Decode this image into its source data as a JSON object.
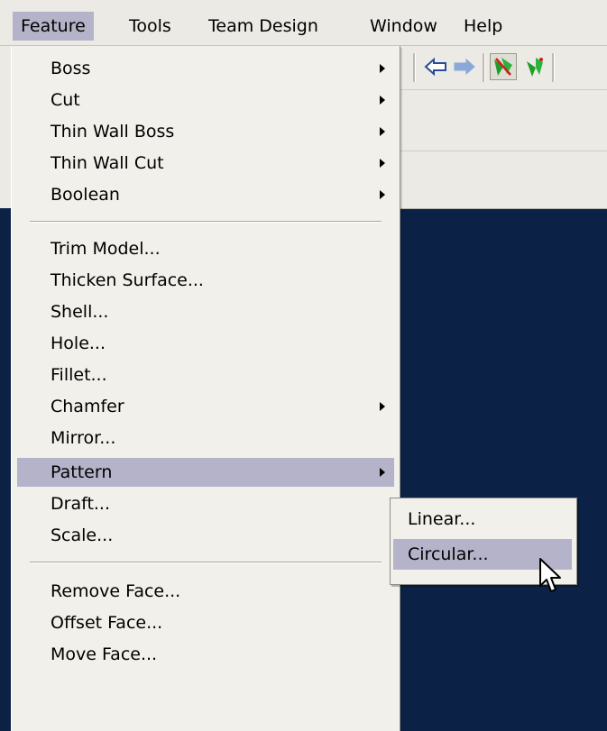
{
  "menubar": {
    "items": [
      {
        "label": "Feature",
        "active": true
      },
      {
        "label": "Tools"
      },
      {
        "label": "Team Design"
      },
      {
        "label": "Window"
      },
      {
        "label": "Help"
      }
    ]
  },
  "toolbar": {
    "icons": [
      "back-arrow-icon",
      "forward-arrow-icon",
      "green-red-feature-icon",
      "green-feature-icon"
    ]
  },
  "feature_menu": {
    "items": [
      {
        "label": "Boss",
        "submenu": true
      },
      {
        "label": "Cut",
        "submenu": true
      },
      {
        "label": "Thin Wall Boss",
        "submenu": true
      },
      {
        "label": "Thin Wall Cut",
        "submenu": true
      },
      {
        "label": "Boolean",
        "submenu": true
      },
      {
        "label": "Trim Model..."
      },
      {
        "label": "Thicken Surface..."
      },
      {
        "label": "Shell..."
      },
      {
        "label": "Hole..."
      },
      {
        "label": "Fillet..."
      },
      {
        "label": "Chamfer",
        "submenu": true
      },
      {
        "label": "Mirror..."
      },
      {
        "label": "Pattern",
        "submenu": true,
        "highlighted": true
      },
      {
        "label": "Draft..."
      },
      {
        "label": "Scale..."
      },
      {
        "label": "Remove Face..."
      },
      {
        "label": "Offset Face..."
      },
      {
        "label": "Move Face..."
      }
    ]
  },
  "pattern_submenu": {
    "items": [
      {
        "label": "Linear..."
      },
      {
        "label": "Circular...",
        "highlighted": true
      }
    ]
  },
  "colors": {
    "menu_bg": "#f1f0ea",
    "highlight": "#b4b3c9",
    "viewport_bg": "#0b2146"
  }
}
